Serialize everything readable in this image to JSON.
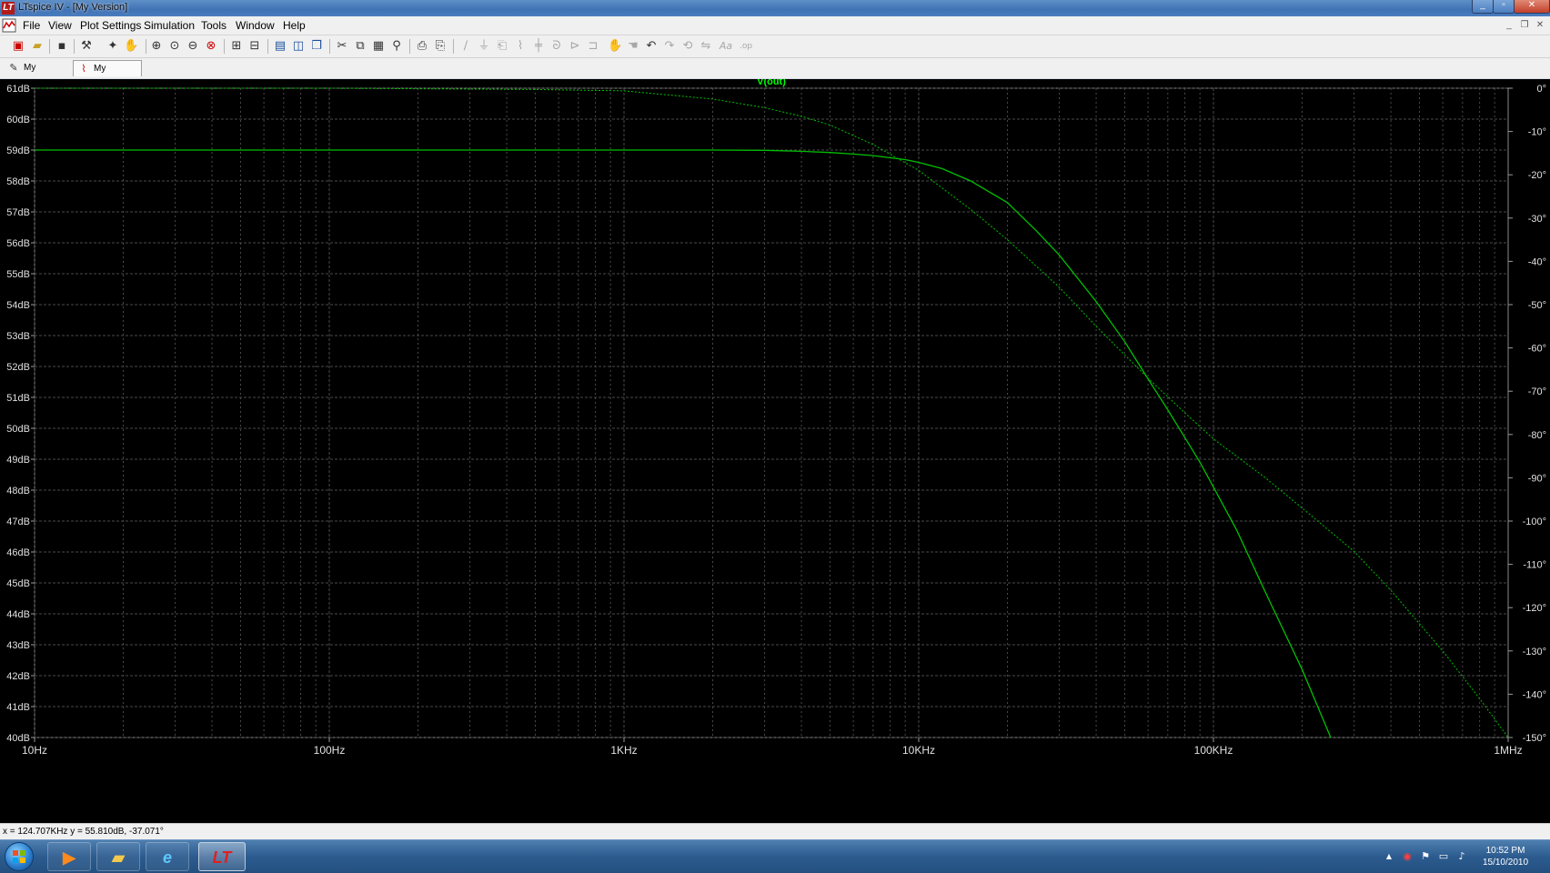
{
  "window": {
    "title": "LTspice IV - [My Version]",
    "controls": [
      "minimize",
      "maximize",
      "close"
    ],
    "mdi_controls": [
      "minimize",
      "restore",
      "close"
    ]
  },
  "menu": [
    "File",
    "View",
    "Plot Settings",
    "Simulation",
    "Tools",
    "Window",
    "Help"
  ],
  "toolbar": {
    "icons": [
      "new-schematic-icon",
      "open-icon",
      "save-icon",
      "control-panel-icon",
      "run-icon",
      "halt-icon",
      "pan-icon",
      "zoom-in-icon",
      "zoom-back-icon",
      "zoom-out-icon",
      "zoom-full-icon",
      "autorange-icon",
      "add-trace-icon",
      "tile-vertical-icon",
      "tile-horizontal-icon",
      "cascade-icon",
      "cut-icon",
      "copy-icon",
      "paste-icon",
      "find-icon",
      "print-icon",
      "print-preview-icon",
      "wire-icon",
      "ground-icon",
      "label-icon",
      "resistor-icon",
      "capacitor-icon",
      "inductor-icon",
      "diode-icon",
      "component-icon",
      "move-icon",
      "drag-icon",
      "undo-icon",
      "redo-icon",
      "rotate-icon",
      "mirror-icon",
      "text-icon",
      "spice-directive-icon"
    ]
  },
  "tabs": [
    {
      "label": "My Version",
      "icon": "schematic-icon",
      "active": false
    },
    {
      "label": "My Version",
      "icon": "waveform-icon",
      "active": true
    }
  ],
  "status": {
    "cursor_readout": "x = 124.707KHz    y = 55.810dB, -37.071°"
  },
  "taskbar": {
    "apps": [
      "media-player-icon",
      "explorer-icon",
      "internet-explorer-icon",
      "ltspice-icon"
    ],
    "time": "10:52 PM",
    "date": "15/10/2010"
  },
  "chart_data": {
    "type": "line",
    "title": "V(out)",
    "x_scale": "log",
    "xlim": [
      10,
      1000000
    ],
    "x_ticks": [
      {
        "value": 10,
        "label": "10Hz"
      },
      {
        "value": 100,
        "label": "100Hz"
      },
      {
        "value": 1000,
        "label": "1KHz"
      },
      {
        "value": 10000,
        "label": "10KHz"
      },
      {
        "value": 100000,
        "label": "100KHz"
      },
      {
        "value": 1000000,
        "label": "1MHz"
      }
    ],
    "ylim_left": [
      40,
      61
    ],
    "y_left_ticks": [
      "61dB",
      "60dB",
      "59dB",
      "58dB",
      "57dB",
      "56dB",
      "55dB",
      "54dB",
      "53dB",
      "52dB",
      "51dB",
      "50dB",
      "49dB",
      "48dB",
      "47dB",
      "46dB",
      "45dB",
      "44dB",
      "43dB",
      "42dB",
      "41dB",
      "40dB"
    ],
    "ylim_right": [
      -150,
      0
    ],
    "y_right_ticks": [
      "0°",
      "-10°",
      "-20°",
      "-30°",
      "-40°",
      "-50°",
      "-60°",
      "-70°",
      "-80°",
      "-90°",
      "-100°",
      "-110°",
      "-120°",
      "-130°",
      "-140°",
      "-150°"
    ],
    "grid": true,
    "colors": {
      "background": "#000000",
      "grid": "#4a4a4a",
      "trace": "#00c000",
      "axis_text": "#e0e0e0",
      "title": "#00ff00"
    },
    "series": [
      {
        "name": "V(out)",
        "style": "solid",
        "axis": "left",
        "points": [
          [
            10,
            59.0
          ],
          [
            100,
            59.0
          ],
          [
            1000,
            59.0
          ],
          [
            2000,
            59.0
          ],
          [
            3000,
            58.99
          ],
          [
            4000,
            58.96
          ],
          [
            5000,
            58.92
          ],
          [
            6000,
            58.87
          ],
          [
            7000,
            58.82
          ],
          [
            8000,
            58.75
          ],
          [
            9000,
            58.69
          ],
          [
            10000,
            58.6
          ],
          [
            12000,
            58.4
          ],
          [
            15000,
            58.0
          ],
          [
            20000,
            57.3
          ],
          [
            25000,
            56.4
          ],
          [
            30000,
            55.6
          ],
          [
            40000,
            54.1
          ],
          [
            50000,
            52.8
          ],
          [
            60000,
            51.6
          ],
          [
            70000,
            50.6
          ],
          [
            80000,
            49.7
          ],
          [
            90000,
            48.9
          ],
          [
            100000,
            48.1
          ],
          [
            120000,
            46.7
          ],
          [
            150000,
            44.7
          ],
          [
            200000,
            42.2
          ],
          [
            250000,
            40.0
          ]
        ]
      },
      {
        "name": "V(out) phase",
        "style": "dotted",
        "axis": "right",
        "points": [
          [
            10,
            0
          ],
          [
            100,
            0
          ],
          [
            500,
            -0.3
          ],
          [
            1000,
            -0.6
          ],
          [
            2000,
            -2.5
          ],
          [
            3000,
            -4.5
          ],
          [
            4000,
            -6.5
          ],
          [
            5000,
            -8.5
          ],
          [
            7000,
            -13
          ],
          [
            10000,
            -19
          ],
          [
            15000,
            -28
          ],
          [
            20000,
            -35
          ],
          [
            30000,
            -46
          ],
          [
            40000,
            -55
          ],
          [
            60000,
            -67
          ],
          [
            80000,
            -75
          ],
          [
            100000,
            -81
          ],
          [
            150000,
            -90
          ],
          [
            200000,
            -97
          ],
          [
            300000,
            -107
          ],
          [
            400000,
            -116
          ],
          [
            600000,
            -130
          ],
          [
            800000,
            -141
          ],
          [
            1000000,
            -150
          ]
        ]
      }
    ]
  }
}
